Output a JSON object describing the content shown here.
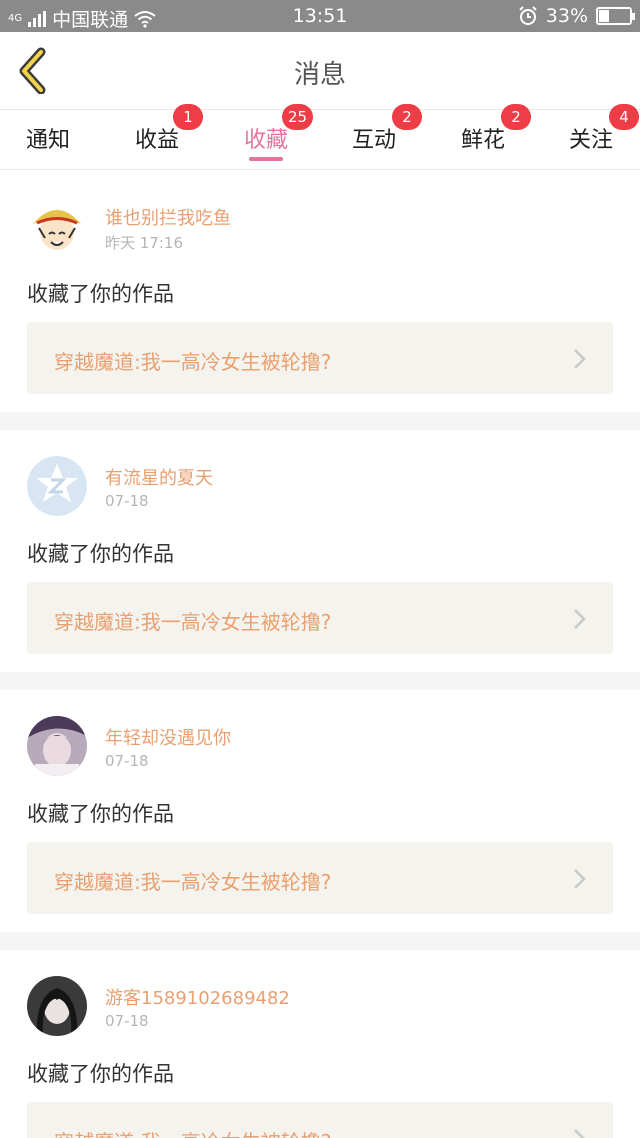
{
  "status_bar": {
    "network_label": "4G",
    "carrier": "中国联通",
    "time": "13:51",
    "battery_percent": "33%",
    "battery_level": 0.33
  },
  "header": {
    "title": "消息",
    "back_icon": "chevron-left-icon"
  },
  "tabs": [
    {
      "label": "通知",
      "badge": "",
      "active": false
    },
    {
      "label": "收益",
      "badge": "1",
      "active": false
    },
    {
      "label": "收藏",
      "badge": "25",
      "active": true
    },
    {
      "label": "互动",
      "badge": "2",
      "active": false
    },
    {
      "label": "鲜花",
      "badge": "2",
      "active": false
    },
    {
      "label": "关注",
      "badge": "4",
      "active": false
    }
  ],
  "messages": [
    {
      "username": "谁也别拦我吃鱼",
      "time": "昨天 17:16",
      "action": "收藏了你的作品",
      "work_title": "穿越魔道:我一高冷女生被轮撸?",
      "avatar": "cartoon-avatar"
    },
    {
      "username": "有流星的夏天",
      "time": "07-18",
      "action": "收藏了你的作品",
      "work_title": "穿越魔道:我一高冷女生被轮撸?",
      "avatar": "default-star-avatar"
    },
    {
      "username": "年轻却没遇见你",
      "time": "07-18",
      "action": "收藏了你的作品",
      "work_title": "穿越魔道:我一高冷女生被轮撸?",
      "avatar": "photo-avatar"
    },
    {
      "username": "游客1589102689482",
      "time": "07-18",
      "action": "收藏了你的作品",
      "work_title": "穿越魔道:我一高冷女生被轮撸?",
      "avatar": "photo-avatar"
    }
  ],
  "colors": {
    "accent_pink": "#e2759e",
    "badge_red": "#ee3d47",
    "username_orange": "#e9a070",
    "link_bg": "#f4f3ee"
  }
}
